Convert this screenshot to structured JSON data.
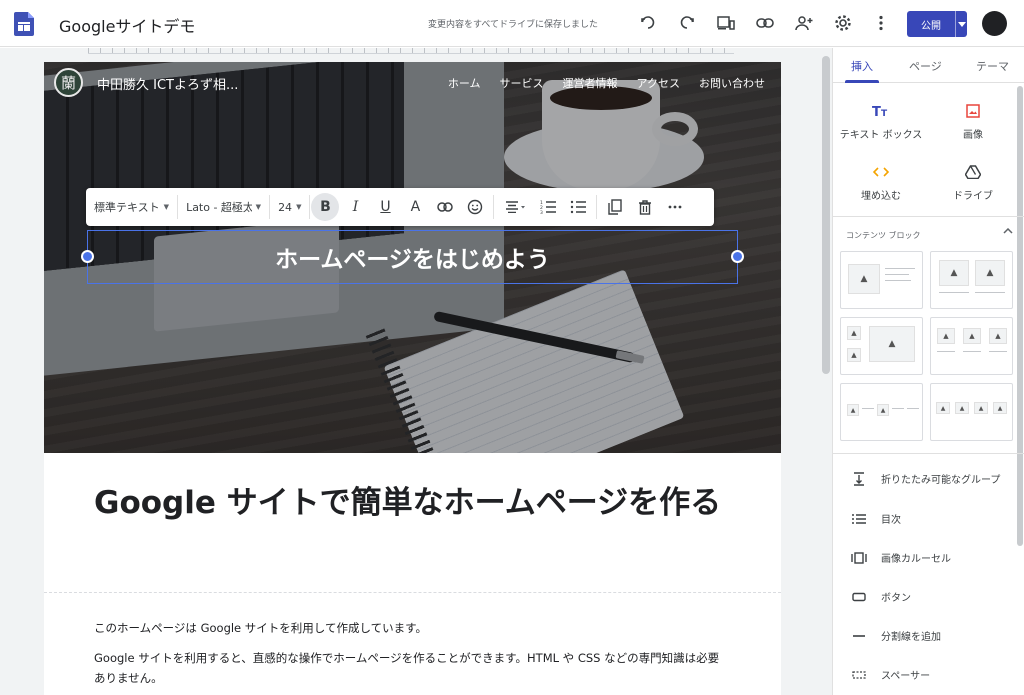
{
  "app": {
    "title": "Googleサイトデモ",
    "saved_status": "変更内容をすべてドライブに保存しました",
    "publish_label": "公開"
  },
  "toolbar_icons": [
    "undo-icon",
    "redo-icon",
    "preview-icon",
    "link-icon",
    "share-icon",
    "settings-icon",
    "more-icon"
  ],
  "site": {
    "logo_glyph": "蘭",
    "name": "中田勝久 ICTよろず相...",
    "nav": [
      "ホーム",
      "サービス",
      "運営者情報",
      "アクセス",
      "お問い合わせ"
    ]
  },
  "format_bar": {
    "style": "標準テキスト",
    "font": "Lato - 超極太",
    "size": "24"
  },
  "hero_heading": "ホームページをはじめよう",
  "content": {
    "heading": "Google サイトで簡単なホームページを作る",
    "para1": "このホームページは Google サイトを利用して作成しています。",
    "para2": "Google サイトを利用すると、直感的な操作でホームページを作ることができます。HTML や CSS などの専門知識は必要ありません。"
  },
  "panel": {
    "tabs": [
      "挿入",
      "ページ",
      "テーマ"
    ],
    "active_tab": "挿入",
    "insert": {
      "text_box": "テキスト ボックス",
      "image": "画像",
      "embed": "埋め込む",
      "drive": "ドライブ"
    },
    "content_blocks_title": "コンテンツ ブロック",
    "items": [
      "折りたたみ可能なグループ",
      "目次",
      "画像カルーセル",
      "ボタン",
      "分割線を追加",
      "スペーサー"
    ]
  },
  "colors": {
    "accent": "#3847b8",
    "selection": "#4a73e8"
  }
}
